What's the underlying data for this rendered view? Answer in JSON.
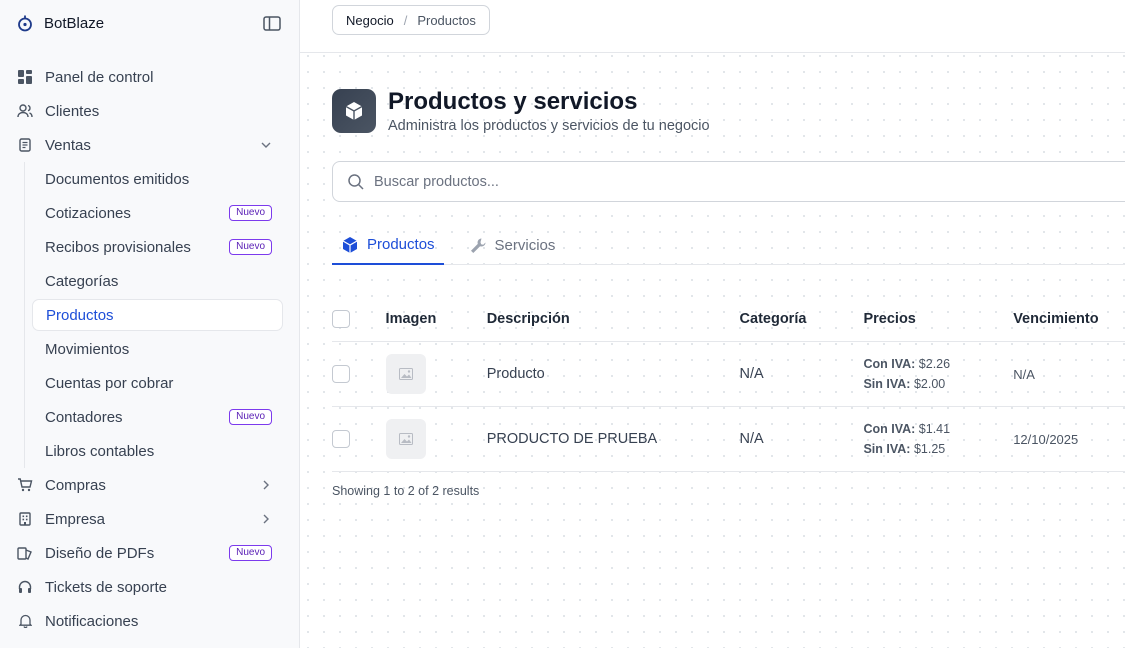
{
  "brand": {
    "name": "BotBlaze"
  },
  "sidebar": {
    "items": [
      {
        "label": "Panel de control"
      },
      {
        "label": "Clientes"
      },
      {
        "label": "Ventas"
      },
      {
        "label": "Compras"
      },
      {
        "label": "Empresa"
      },
      {
        "label": "Diseño de PDFs",
        "badge": "Nuevo"
      },
      {
        "label": "Tickets de soporte"
      },
      {
        "label": "Notificaciones"
      }
    ],
    "ventas_sub": [
      {
        "label": "Documentos emitidos"
      },
      {
        "label": "Cotizaciones",
        "badge": "Nuevo"
      },
      {
        "label": "Recibos provisionales",
        "badge": "Nuevo"
      },
      {
        "label": "Categorías"
      },
      {
        "label": "Productos",
        "active": true
      },
      {
        "label": "Movimientos"
      },
      {
        "label": "Cuentas por cobrar"
      },
      {
        "label": "Contadores",
        "badge": "Nuevo"
      },
      {
        "label": "Libros contables"
      }
    ]
  },
  "breadcrumb": {
    "parent": "Negocio",
    "separator": "/",
    "current": "Productos"
  },
  "header": {
    "title": "Productos y servicios",
    "subtitle": "Administra los productos y servicios de tu negocio"
  },
  "search": {
    "placeholder": "Buscar productos...",
    "value": ""
  },
  "tabs": [
    {
      "label": "Productos",
      "active": true,
      "icon": "cube-icon"
    },
    {
      "label": "Servicios",
      "active": false,
      "icon": "wrench-icon"
    }
  ],
  "table": {
    "columns": [
      "Imagen",
      "Descripción",
      "Categoría",
      "Precios",
      "Vencimiento"
    ],
    "rows": [
      {
        "description": "Producto",
        "category": "N/A",
        "price_with_iva_label": "Con IVA:",
        "price_with_iva": "$2.26",
        "price_without_iva_label": "Sin IVA:",
        "price_without_iva": "$2.00",
        "expiry": "N/A"
      },
      {
        "description": "PRODUCTO DE PRUEBA",
        "category": "N/A",
        "price_with_iva_label": "Con IVA:",
        "price_with_iva": "$1.41",
        "price_without_iva_label": "Sin IVA:",
        "price_without_iva": "$1.25",
        "expiry": "12/10/2025"
      }
    ]
  },
  "footer": {
    "results_text": "Showing 1 to 2 of 2 results"
  },
  "colors": {
    "accent": "#1d4ed8",
    "badge": "#7c3aed",
    "sidebar_bg": "#f8f9fb"
  }
}
